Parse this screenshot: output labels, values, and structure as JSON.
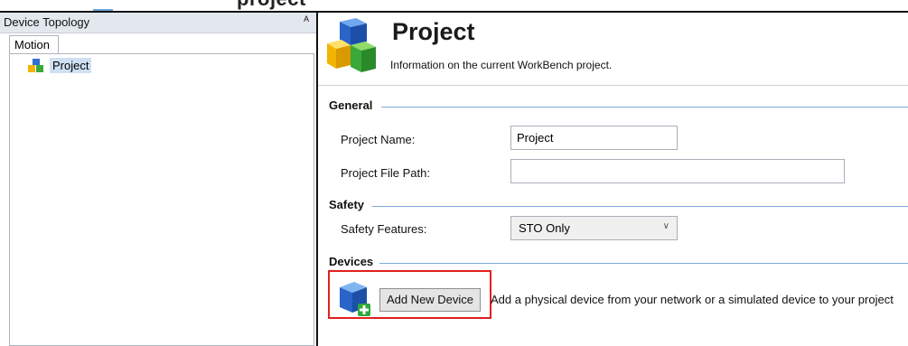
{
  "window": {
    "cut_heading": "project"
  },
  "left_panel": {
    "title": "Device Topology",
    "pin_icon": "pin-icon",
    "tab_label": "Motion",
    "tree_items": [
      {
        "label": "Project",
        "icon": "project-cube-icon"
      }
    ]
  },
  "project_header": {
    "title": "Project",
    "subtitle": "Information on the current WorkBench project.",
    "icon": "project-cubes-icon"
  },
  "general": {
    "section_title": "General",
    "project_name_label": "Project Name:",
    "project_name_value": "Project",
    "project_file_path_label": "Project File Path:",
    "project_file_path_value": ""
  },
  "safety": {
    "section_title": "Safety",
    "safety_features_label": "Safety Features:",
    "safety_features_value": "STO Only"
  },
  "devices": {
    "section_title": "Devices",
    "add_button_label": "Add New Device",
    "add_description": "Add a physical device from your network or a simulated device to your project",
    "icon": "add-device-icon"
  },
  "colors": {
    "highlight": "#e02020",
    "section_line": "#7fa8d8",
    "tree_selection": "#cfe0f3"
  }
}
